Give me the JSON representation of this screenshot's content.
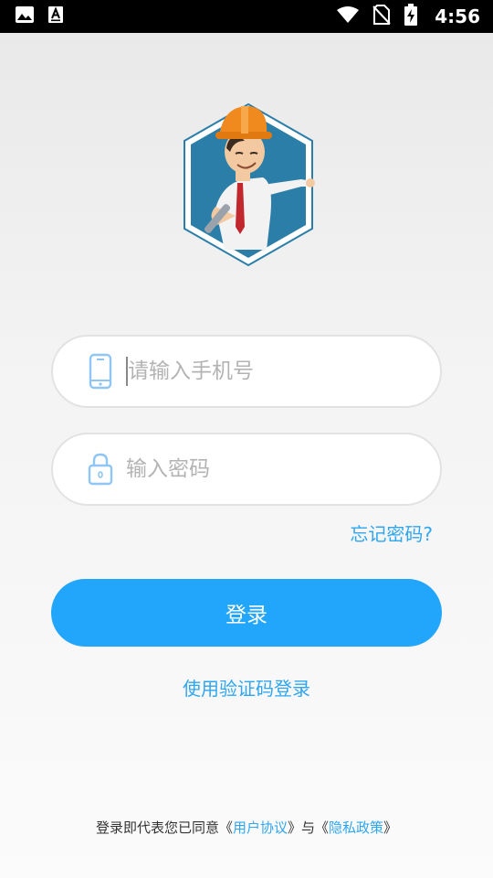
{
  "status_bar": {
    "time": "4:56",
    "icons": [
      "image-icon",
      "a-icon",
      "wifi-icon",
      "no-sim-icon",
      "battery-charging-icon"
    ]
  },
  "login_form": {
    "phone_placeholder": "请输入手机号",
    "password_placeholder": "输入密码",
    "forgot_password": "忘记密码?",
    "login_button": "登录",
    "code_login": "使用验证码登录"
  },
  "agreement": {
    "prefix": "登录即代表您已同意",
    "open_quote_1": "《",
    "user_agreement": "用户协议",
    "close_quote_1": "》",
    "conjunction": "与",
    "open_quote_2": "《",
    "privacy_policy": "隐私政策",
    "close_quote_2": "》"
  },
  "colors": {
    "accent": "#21a6fb",
    "link": "#2fa6ef",
    "logo_hex": "#2b7ea8"
  }
}
